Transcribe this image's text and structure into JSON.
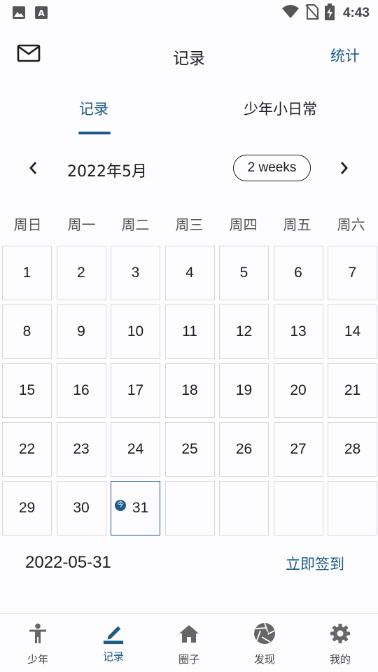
{
  "status_bar": {
    "time": "4:43",
    "icons": [
      "image-icon",
      "font-icon",
      "wifi-icon",
      "no-sim-icon",
      "battery-charging-icon"
    ]
  },
  "app_bar": {
    "title": "记录",
    "left_icon": "mail-icon",
    "right_action": "统计"
  },
  "tabs": [
    {
      "label": "记录",
      "active": true
    },
    {
      "label": "少年小日常",
      "active": false
    }
  ],
  "calendar": {
    "month_label": "2022年5月",
    "view_mode": "2 weeks",
    "weekdays": [
      "周日",
      "周一",
      "周二",
      "周三",
      "周四",
      "周五",
      "周六"
    ],
    "days": [
      "1",
      "2",
      "3",
      "4",
      "5",
      "6",
      "7",
      "8",
      "9",
      "10",
      "11",
      "12",
      "13",
      "14",
      "15",
      "16",
      "17",
      "18",
      "19",
      "20",
      "21",
      "22",
      "23",
      "24",
      "25",
      "26",
      "27",
      "28",
      "29",
      "30",
      "31",
      "",
      "",
      "",
      ""
    ],
    "today_index": 30,
    "today_badge": "今"
  },
  "footer": {
    "selected_date": "2022-05-31",
    "sign_in": "立即签到"
  },
  "bottom_nav": [
    {
      "label": "少年",
      "icon": "person-icon",
      "active": false
    },
    {
      "label": "记录",
      "icon": "edit-icon",
      "active": true
    },
    {
      "label": "圈子",
      "icon": "home-icon",
      "active": false
    },
    {
      "label": "发现",
      "icon": "aperture-icon",
      "active": false
    },
    {
      "label": "我的",
      "icon": "gear-icon",
      "active": false
    }
  ],
  "colors": {
    "accent": "#1c5b86",
    "text": "#1c1b1f",
    "grid_border": "#d8d8d8"
  }
}
